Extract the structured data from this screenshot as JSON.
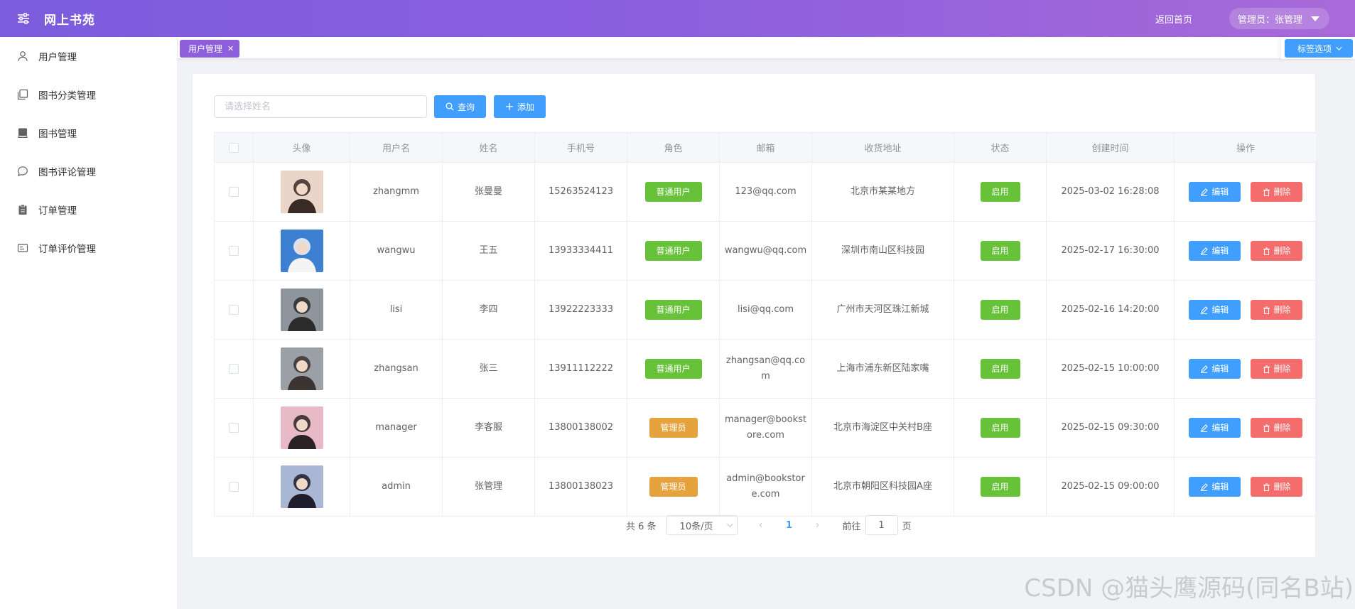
{
  "header": {
    "title": "网上书苑",
    "home_link": "返回首页",
    "user": "管理员：张管理"
  },
  "sidebar": {
    "items": [
      {
        "label": "用户管理",
        "icon": "user-icon"
      },
      {
        "label": "图书分类管理",
        "icon": "copy-icon"
      },
      {
        "label": "图书管理",
        "icon": "book-icon"
      },
      {
        "label": "图书评论管理",
        "icon": "chat-icon"
      },
      {
        "label": "订单管理",
        "icon": "clipboard-icon"
      },
      {
        "label": "订单评价管理",
        "icon": "card-icon"
      }
    ]
  },
  "tags": {
    "active_tag": "用户管理",
    "options_label": "标签选项"
  },
  "toolbar": {
    "search_placeholder": "请选择姓名",
    "query_label": "查询",
    "add_label": "添加"
  },
  "table": {
    "columns": [
      "",
      "头像",
      "用户名",
      "姓名",
      "手机号",
      "角色",
      "邮箱",
      "收货地址",
      "状态",
      "创建时间",
      "操作"
    ],
    "rows": [
      {
        "username": "zhangmm",
        "name": "张曼曼",
        "phone": "15263524123",
        "role": "普通用户",
        "role_type": "user",
        "email": "123@qq.com",
        "address": "北京市某某地方",
        "status": "启用",
        "created": "2025-03-02 16:28:08",
        "avatar_colors": [
          "#e9d6c9",
          "#3a2a25"
        ]
      },
      {
        "username": "wangwu",
        "name": "王五",
        "phone": "13933334411",
        "role": "普通用户",
        "role_type": "user",
        "email": "wangwu@qq.com",
        "address": "深圳市南山区科技园",
        "status": "启用",
        "created": "2025-02-17 16:30:00",
        "avatar_colors": [
          "#3d7fd1",
          "#f4f4f4"
        ]
      },
      {
        "username": "lisi",
        "name": "李四",
        "phone": "13922223333",
        "role": "普通用户",
        "role_type": "user",
        "email": "lisi@qq.com",
        "address": "广州市天河区珠江新城",
        "status": "启用",
        "created": "2025-02-16 14:20:00",
        "avatar_colors": [
          "#8f959c",
          "#2b2b2b"
        ]
      },
      {
        "username": "zhangsan",
        "name": "张三",
        "phone": "13911112222",
        "role": "普通用户",
        "role_type": "user",
        "email": "zhangsan@qq.com",
        "address": "上海市浦东新区陆家嘴",
        "status": "启用",
        "created": "2025-02-15 10:00:00",
        "avatar_colors": [
          "#9aa0a6",
          "#3b3431"
        ]
      },
      {
        "username": "manager",
        "name": "李客服",
        "phone": "13800138002",
        "role": "管理员",
        "role_type": "admin",
        "email": "manager@bookstore.com",
        "address": "北京市海淀区中关村B座",
        "status": "启用",
        "created": "2025-02-15 09:30:00",
        "avatar_colors": [
          "#e8b9c6",
          "#2a2224"
        ]
      },
      {
        "username": "admin",
        "name": "张管理",
        "phone": "13800138023",
        "role": "管理员",
        "role_type": "admin",
        "email": "admin@bookstore.com",
        "address": "北京市朝阳区科技园A座",
        "status": "启用",
        "created": "2025-02-15 09:00:00",
        "avatar_colors": [
          "#a9b6d4",
          "#1f1c2c"
        ]
      }
    ],
    "edit_label": "编辑",
    "delete_label": "删除"
  },
  "pagination": {
    "total": "共 6 条",
    "page_size": "10条/页",
    "current_page": "1",
    "jump_prefix": "前往",
    "jump_value": "1",
    "jump_suffix": "页"
  },
  "watermark": "CSDN @猫头鹰源码(同名B站)",
  "colors": {
    "primary": "#409eff",
    "success": "#67c23a",
    "warning": "#e6a23c",
    "danger": "#f56c6c",
    "header_gradient_start": "#7b5cdd",
    "header_gradient_end": "#a86ad8",
    "tag_active": "#8e5fdc"
  }
}
